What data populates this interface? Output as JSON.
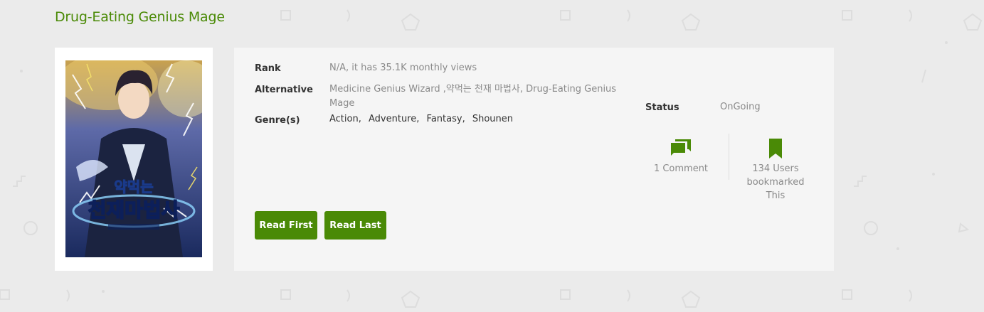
{
  "series_title": "Drug-Eating Genius Mage",
  "cover": {
    "korean_title_line1": "약먹는",
    "korean_title_line2": "천재마법사"
  },
  "info": {
    "rank_label": "Rank",
    "rank_value": "N/A, it has 35.1K monthly views",
    "alternative_label": "Alternative",
    "alternative_value_line1": "Medicine Genius Wizard ,약먹는 천재 마법사, Drug-Eating Genius",
    "alternative_value_line2": "Mage",
    "genres_label": "Genre(s)",
    "genres": [
      "Action",
      "Adventure",
      "Fantasy",
      "Shounen"
    ],
    "status_label": "Status",
    "status_value": "OnGoing"
  },
  "stats": {
    "comments_label": "1 Comment",
    "bookmarks_line1": "134 Users",
    "bookmarks_line2": "bookmarked",
    "bookmarks_line3": "This"
  },
  "buttons": {
    "read_first": "Read First",
    "read_last": "Read Last"
  },
  "colors": {
    "accent": "#4a8a06",
    "panel_bg": "#f5f5f5",
    "page_bg": "#ebebeb"
  },
  "icons": {
    "comments": "comments-icon",
    "bookmark": "bookmark-icon"
  }
}
